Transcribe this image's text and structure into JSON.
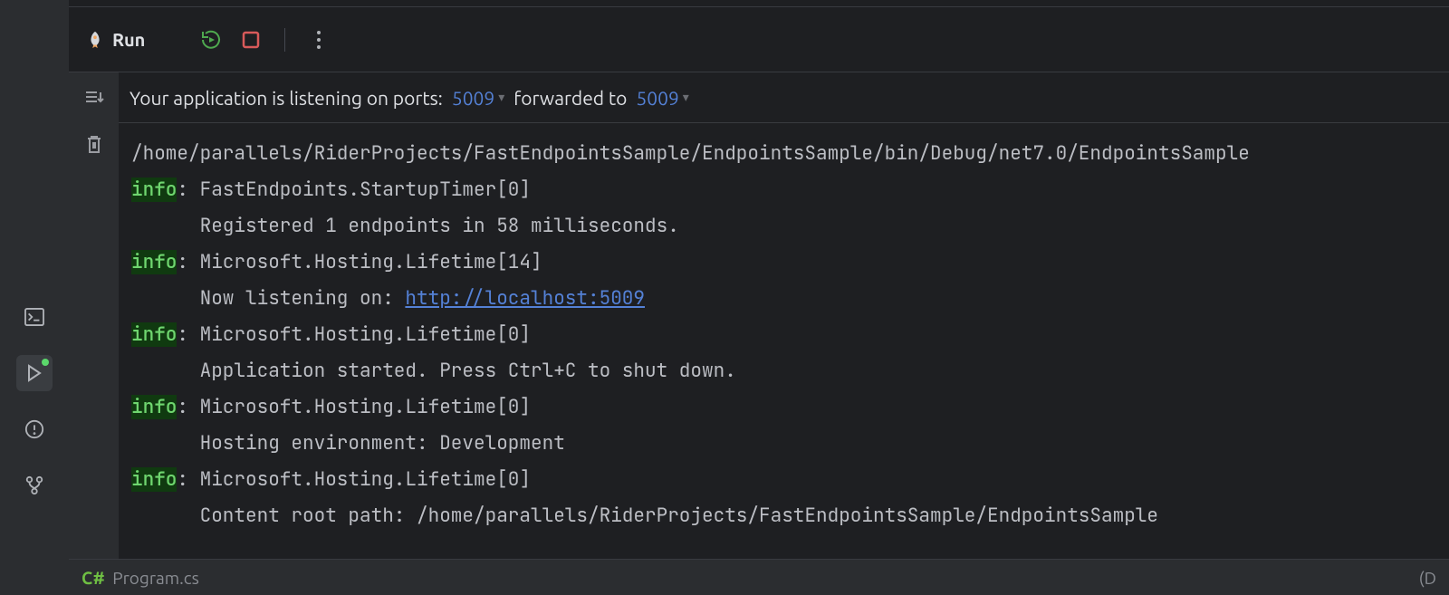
{
  "toolbar": {
    "run_label": "Run"
  },
  "ports": {
    "prefix": "Your application is listening on ports:",
    "port1": "5009",
    "mid": "forwarded to",
    "port2": "5009"
  },
  "console": {
    "path": "/home/parallels/RiderProjects/FastEndpointsSample/EndpointsSample/bin/Debug/net7.0/EndpointsSample",
    "lines": [
      {
        "tag": "info",
        "source": "FastEndpoints.StartupTimer[0]",
        "msg": "Registered 1 endpoints in 58 milliseconds."
      },
      {
        "tag": "info",
        "source": "Microsoft.Hosting.Lifetime[14]",
        "msg_prefix": "Now listening on: ",
        "url": "http://localhost:5009"
      },
      {
        "tag": "info",
        "source": "Microsoft.Hosting.Lifetime[0]",
        "msg": "Application started. Press Ctrl+C to shut down."
      },
      {
        "tag": "info",
        "source": "Microsoft.Hosting.Lifetime[0]",
        "msg": "Hosting environment: Development"
      },
      {
        "tag": "info",
        "source": "Microsoft.Hosting.Lifetime[0]",
        "msg": "Content root path: /home/parallels/RiderProjects/FastEndpointsSample/EndpointsSample"
      }
    ]
  },
  "status": {
    "lang": "C#",
    "file": "Program.cs",
    "right": "(D"
  }
}
